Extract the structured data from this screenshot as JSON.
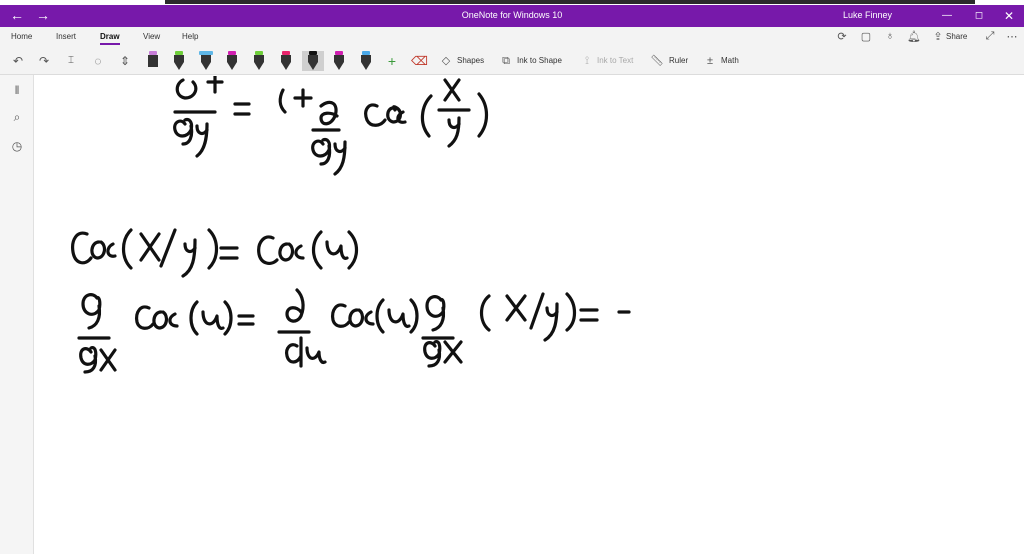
{
  "window": {
    "title": "OneNote for Windows 10",
    "user": "Luke Finney",
    "nav_back": "←",
    "nav_forward": "→",
    "minimize": "—",
    "maximize": "◻",
    "close": "✕",
    "accent_color": "#7719aa"
  },
  "ribbon": {
    "tabs": [
      {
        "label": "Home"
      },
      {
        "label": "Insert"
      },
      {
        "label": "Draw",
        "active": true
      },
      {
        "label": "View"
      },
      {
        "label": "Help"
      }
    ],
    "share_label": "Share",
    "toolbar": {
      "shapes_label": "Shapes",
      "ink_to_shape_label": "Ink to Shape",
      "ink_to_text_label": "Ink to Text",
      "ruler_label": "Ruler",
      "math_label": "Math"
    },
    "pens": [
      {
        "color": "#c77dd8"
      },
      {
        "color": "#6fcf3a"
      },
      {
        "color": "#5fb7e8"
      },
      {
        "color": "#d11fb1"
      },
      {
        "color": "#6fcf3a"
      },
      {
        "color": "#e8246c"
      },
      {
        "color": "#111111"
      },
      {
        "color": "#d11fb1"
      },
      {
        "color": "#4aa8e8"
      }
    ]
  },
  "sidebar": {
    "items": [
      {
        "icon": "notebooks-icon"
      },
      {
        "icon": "search-icon"
      },
      {
        "icon": "recent-icon"
      }
    ]
  }
}
